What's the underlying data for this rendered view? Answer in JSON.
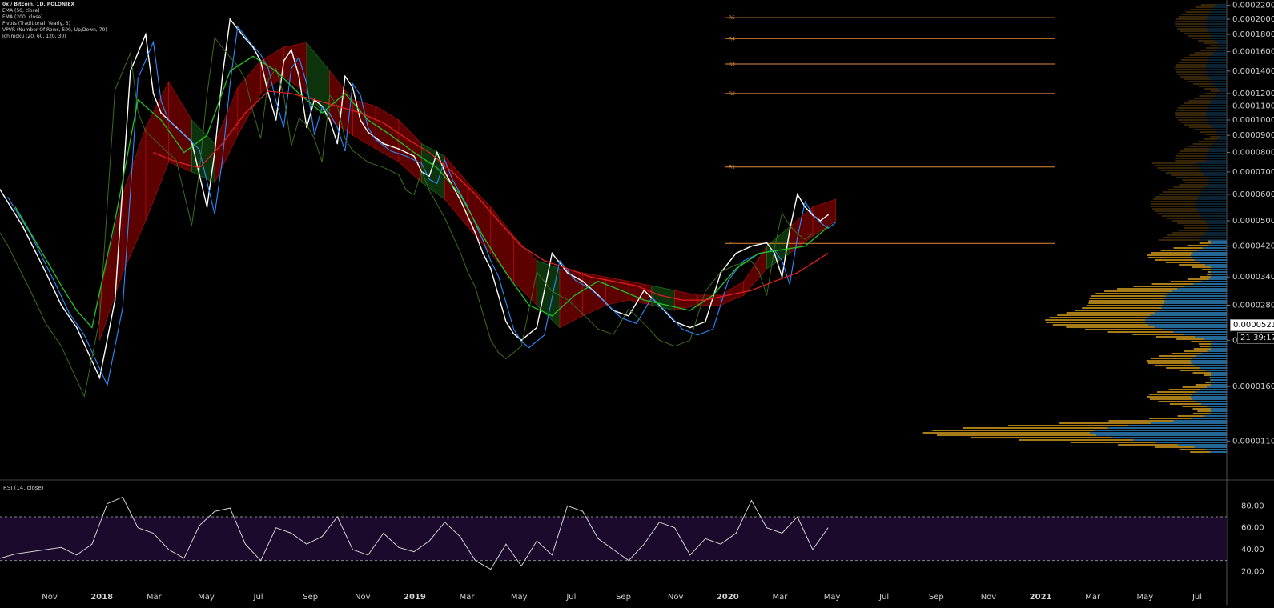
{
  "legend": {
    "symbol": "0x / Bitcoin, 1D, POLONIEX",
    "ema50": "EMA (50, close)",
    "ema200": "EMA (200, close)",
    "pivots": "Pivots (Traditional, Yearly, 3)",
    "vpvr": "VPVR (Number Of Rows, 500, Up/Down, 70)",
    "ichimoku": "Ichimoku (20, 60, 120, 30)"
  },
  "rsi_title": "RSI (14, close)",
  "current_price": "0.00005215",
  "countdown": "21:39:17",
  "colors": {
    "price": "#ffffff",
    "ema50": "#22c322",
    "ema200": "#e02020",
    "conversion": "#2a8cff",
    "lagging": "#3b6d1e",
    "cloud_bear": "#6e0000",
    "cloud_bull": "#0f3d0f",
    "pivot": "#e08a3a",
    "vol_up": "#2a78b0",
    "vol_down": "#c4911c",
    "rsi": "#d0d0d0",
    "rsi_band": "#1c0a2c"
  },
  "pivots": [
    {
      "label": "R5",
      "value": 0.000202
    },
    {
      "label": "R4",
      "value": 0.000175
    },
    {
      "label": "R3",
      "value": 0.000147
    },
    {
      "label": "R2",
      "value": 0.00012
    },
    {
      "label": "R1",
      "value": 7.24e-05
    },
    {
      "label": "P",
      "value": 4.28e-05
    }
  ],
  "chart_data": [
    {
      "type": "line",
      "scale": "log",
      "ylim": [
        9.5e-06,
        0.000222
      ],
      "y_ticks": [
        "0.00022000",
        "0.00020000",
        "0.00018000",
        "0.00016000",
        "0.00014000",
        "0.00012000",
        "0.00011000",
        "0.00010000",
        "0.00009000",
        "0.00008000",
        "0.00007000",
        "0.00006000",
        "0.00005000",
        "0.00004200",
        "0.00003400",
        "0.00002800",
        "0.00002200",
        "0.00001600",
        "0.00001100"
      ],
      "x_ticks": [
        "Nov",
        "2018",
        "Mar",
        "May",
        "Jul",
        "Sep",
        "Nov",
        "2019",
        "Mar",
        "May",
        "Jul",
        "Sep",
        "Nov",
        "2020",
        "Mar",
        "May",
        "Jul",
        "Sep",
        "Nov",
        "2021",
        "Mar",
        "May",
        "Jul"
      ],
      "series": [
        {
          "key": "price",
          "x": [
            0,
            3,
            6,
            8,
            10,
            13,
            15,
            17,
            19,
            20,
            21,
            23,
            25,
            27,
            28,
            29,
            30,
            32,
            33,
            34,
            35,
            36,
            37,
            38,
            39,
            40,
            41,
            42,
            43,
            44,
            45,
            46,
            47,
            48,
            50,
            52,
            54,
            55,
            56,
            57,
            58,
            60,
            62,
            63,
            64,
            65,
            66,
            67,
            68,
            70,
            72,
            74,
            76,
            78,
            80,
            82,
            84,
            86,
            88,
            90,
            92,
            94,
            96,
            98,
            100,
            101,
            102,
            103,
            104,
            105,
            106,
            107,
            108
          ],
          "y": [
            6.2e-05,
            4.8e-05,
            3.5e-05,
            2.8e-05,
            2.4e-05,
            1.7e-05,
            2.9e-05,
            0.00014,
            0.00018,
            0.00012,
            0.000105,
            9.5e-05,
            8.6e-05,
            5.5e-05,
            8e-05,
            0.000135,
            0.0002,
            0.000175,
            0.000165,
            0.00015,
            0.00012,
            0.0001,
            0.00015,
            0.000162,
            0.000135,
            9.5e-05,
            0.000115,
            0.00011,
            0.0001,
            8.5e-05,
            0.000135,
            0.000125,
            0.0001,
            9.2e-05,
            8.5e-05,
            8.2e-05,
            7.8e-05,
            7e-05,
            6.8e-05,
            8e-05,
            7e-05,
            5.8e-05,
            4.6e-05,
            4e-05,
            3.6e-05,
            3e-05,
            2.5e-05,
            2.3e-05,
            2.2e-05,
            2.4e-05,
            4e-05,
            3.5e-05,
            3.3e-05,
            3e-05,
            2.7e-05,
            2.6e-05,
            3.1e-05,
            2.8e-05,
            2.5e-05,
            2.4e-05,
            2.5e-05,
            3.5e-05,
            4e-05,
            4.2e-05,
            4.3e-05,
            4e-05,
            3.4e-05,
            4.7e-05,
            6e-05,
            5.5e-05,
            5.2e-05,
            5e-05,
            5.21e-05
          ]
        },
        {
          "key": "ema50",
          "x": [
            2,
            5,
            8,
            10,
            12,
            15,
            18,
            21,
            24,
            27,
            30,
            33,
            36,
            39,
            42,
            45,
            48,
            51,
            54,
            57,
            60,
            63,
            66,
            69,
            72,
            75,
            78,
            81,
            84,
            87,
            90,
            93,
            96,
            99,
            102,
            105,
            108
          ],
          "y": [
            5.5e-05,
            4.2e-05,
            3.2e-05,
            2.7e-05,
            2.4e-05,
            5e-05,
            0.000115,
            0.0001,
            8e-05,
            9e-05,
            0.00014,
            0.000155,
            0.00014,
            0.00012,
            0.000105,
            0.00012,
            0.0001,
            9e-05,
            8e-05,
            7.2e-05,
            6e-05,
            4.5e-05,
            3.5e-05,
            2.8e-05,
            2.6e-05,
            3e-05,
            3.3e-05,
            3.1e-05,
            2.9e-05,
            2.8e-05,
            2.7e-05,
            3e-05,
            3.6e-05,
            4e-05,
            4.1e-05,
            4.2e-05,
            4.8e-05
          ]
        },
        {
          "key": "ema200",
          "x": [
            20,
            23,
            26,
            29,
            32,
            35,
            38,
            41,
            44,
            47,
            50,
            53,
            56,
            59,
            62,
            65,
            68,
            71,
            74,
            77,
            80,
            83,
            86,
            89,
            92,
            95,
            98,
            101,
            104,
            108
          ],
          "y": [
            8e-05,
            7.5e-05,
            7.2e-05,
            8.5e-05,
            0.000105,
            0.000122,
            0.00012,
            0.000115,
            0.00011,
            0.000105,
            9.8e-05,
            8.8e-05,
            8e-05,
            7e-05,
            6e-05,
            5e-05,
            4.2e-05,
            3.8e-05,
            3.6e-05,
            3.4e-05,
            3.3e-05,
            3.2e-05,
            3e-05,
            2.9e-05,
            2.9e-05,
            3e-05,
            3.1e-05,
            3.3e-05,
            3.5e-05,
            4e-05
          ]
        }
      ],
      "ichimoku_cloud": {
        "x": [
          13,
          16,
          19,
          22,
          25,
          28,
          31,
          34,
          37,
          40,
          43,
          46,
          49,
          52,
          55,
          58,
          61,
          64,
          67,
          70,
          73,
          76,
          79,
          82,
          85,
          88,
          91,
          94,
          97,
          100,
          103,
          106,
          109
        ],
        "upper": [
          3e-05,
          6e-05,
          9.5e-05,
          0.00013,
          0.0001,
          8.5e-05,
          0.000125,
          0.00015,
          0.000165,
          0.00017,
          0.00014,
          0.000115,
          0.00011,
          0.0001,
          8.5e-05,
          7.8e-05,
          6.5e-05,
          5.5e-05,
          4.5e-05,
          3.8e-05,
          3.6e-05,
          3.5e-05,
          3.4e-05,
          3.3e-05,
          3.2e-05,
          3.1e-05,
          3e-05,
          3e-05,
          3.3e-05,
          4.2e-05,
          4.8e-05,
          5.5e-05,
          5.8e-05
        ],
        "lower": [
          2.2e-05,
          3.5e-05,
          5e-05,
          7.5e-05,
          7e-05,
          6.5e-05,
          9e-05,
          0.00012,
          0.000135,
          0.00012,
          0.0001,
          9e-05,
          8.2e-05,
          7.5e-05,
          6.5e-05,
          5.8e-05,
          4.8e-05,
          4e-05,
          3.3e-05,
          2.8e-05,
          2.4e-05,
          2.6e-05,
          2.8e-05,
          2.9e-05,
          2.8e-05,
          2.7e-05,
          2.8e-05,
          2.8e-05,
          3e-05,
          3.6e-05,
          4e-05,
          4.5e-05,
          5e-05
        ]
      }
    },
    {
      "type": "line",
      "title": "RSI (14, close)",
      "ylim": [
        10,
        100
      ],
      "y_ticks": [
        "80.00",
        "60.00",
        "40.00",
        "20.00"
      ],
      "bands": [
        30,
        70
      ],
      "x": [
        0,
        2,
        4,
        6,
        8,
        10,
        12,
        14,
        16,
        18,
        20,
        22,
        24,
        26,
        28,
        30,
        32,
        34,
        36,
        38,
        40,
        42,
        44,
        46,
        48,
        50,
        52,
        54,
        56,
        58,
        60,
        62,
        64,
        66,
        68,
        70,
        72,
        74,
        76,
        78,
        80,
        82,
        84,
        86,
        88,
        90,
        92,
        94,
        96,
        98,
        100,
        102,
        104,
        106,
        108
      ],
      "values": [
        32,
        36,
        38,
        40,
        42,
        35,
        45,
        82,
        88,
        60,
        55,
        40,
        32,
        62,
        75,
        78,
        45,
        30,
        60,
        55,
        45,
        52,
        70,
        40,
        35,
        55,
        42,
        38,
        48,
        65,
        52,
        30,
        22,
        45,
        25,
        48,
        35,
        80,
        75,
        50,
        40,
        30,
        45,
        65,
        60,
        35,
        50,
        45,
        55,
        85,
        60,
        55,
        70,
        40,
        60
      ]
    }
  ]
}
